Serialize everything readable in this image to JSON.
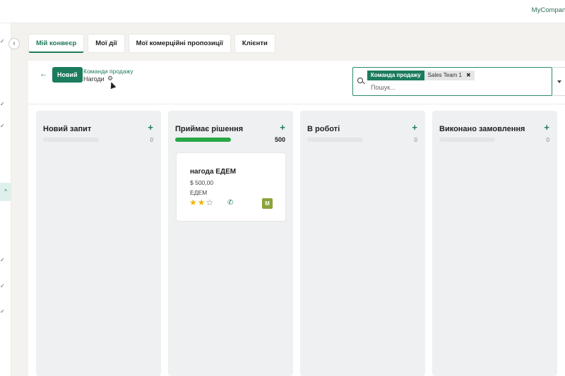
{
  "topbar": {
    "company": "MyCompany"
  },
  "sidebar": {
    "collapse_label": "‹",
    "check_mark": "✓",
    "active_mark": "^"
  },
  "tabs": [
    {
      "label": "Мій конвеєр",
      "active": true
    },
    {
      "label": "Мої дії",
      "active": false
    },
    {
      "label": "Мої комерційні пропозиції",
      "active": false
    },
    {
      "label": "Клієнти",
      "active": false
    }
  ],
  "control_panel": {
    "back_icon": "←",
    "new_label": "Новий",
    "breadcrumb_parent": "Команди продажу",
    "breadcrumb_current": "Нагоди",
    "gear_icon": "⚙"
  },
  "search": {
    "facet_label": "Команда продажу",
    "facet_value": "Sales Team 1",
    "facet_remove": "✖",
    "placeholder": "Пошук..."
  },
  "kanban": {
    "columns": [
      {
        "title": "Новий запит",
        "add": "+",
        "total": "0",
        "progress": 0
      },
      {
        "title": "Приймає рішення",
        "add": "+",
        "total": "500",
        "progress": 1
      },
      {
        "title": "В роботі",
        "add": "+",
        "total": "0",
        "progress": 0
      },
      {
        "title": "Виконано замовлення",
        "add": "+",
        "total": "0",
        "progress": 0
      }
    ],
    "card": {
      "name": "нагода ЕДЕМ",
      "amount": "$ 500,00",
      "company": "ЕДЕМ",
      "rating": 2,
      "rating_max": 3,
      "star_on": "★",
      "star_off": "☆",
      "phone_icon": "✆",
      "avatar_initial": "M"
    }
  },
  "colors": {
    "accent": "#1b7b5d",
    "progress": "#28a745",
    "star": "#f0b400",
    "avatar": "#8aa33a"
  }
}
